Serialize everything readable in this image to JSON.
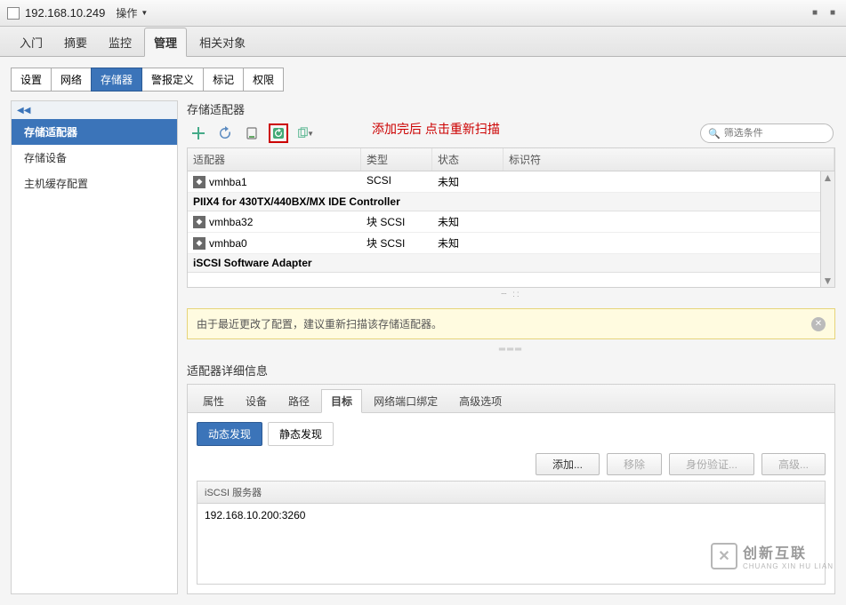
{
  "topbar": {
    "host": "192.168.10.249",
    "ops_label": "操作"
  },
  "main_tabs": [
    "入门",
    "摘要",
    "监控",
    "管理",
    "相关对象"
  ],
  "main_tab_active": 3,
  "sub_tabs": [
    "设置",
    "网络",
    "存储器",
    "警报定义",
    "标记",
    "权限"
  ],
  "sub_tab_active": 2,
  "sidebar": {
    "items": [
      "存储适配器",
      "存储设备",
      "主机缓存配置"
    ],
    "selected": 0
  },
  "section_title": "存储适配器",
  "annotation": "添加完后 点击重新扫描",
  "search": {
    "placeholder": "筛选条件"
  },
  "grid": {
    "headers": [
      "适配器",
      "类型",
      "状态",
      "标识符"
    ],
    "rows": [
      {
        "type": "adapter",
        "name": "vmhba1",
        "atype": "SCSI",
        "status": "未知",
        "id": ""
      },
      {
        "type": "group",
        "label": "PIIX4 for 430TX/440BX/MX IDE Controller"
      },
      {
        "type": "adapter",
        "name": "vmhba32",
        "atype": "块 SCSI",
        "status": "未知",
        "id": ""
      },
      {
        "type": "adapter",
        "name": "vmhba0",
        "atype": "块 SCSI",
        "status": "未知",
        "id": ""
      },
      {
        "type": "group",
        "label": "iSCSI Software Adapter"
      }
    ]
  },
  "warning": {
    "text": "由于最近更改了配置，建议重新扫描该存储适配器。"
  },
  "detail_title": "适配器详细信息",
  "detail_tabs": [
    "属性",
    "设备",
    "路径",
    "目标",
    "网络端口绑定",
    "高级选项"
  ],
  "detail_tab_active": 3,
  "discovery_tabs": [
    "动态发现",
    "静态发现"
  ],
  "discovery_active": 0,
  "actions": {
    "add": "添加...",
    "remove": "移除",
    "auth": "身份验证...",
    "advanced": "高级..."
  },
  "server_grid": {
    "header": "iSCSI 服务器",
    "rows": [
      "192.168.10.200:3260"
    ]
  },
  "watermark": {
    "cn": "创新互联",
    "en": "CHUANG XIN HU LIAN"
  }
}
